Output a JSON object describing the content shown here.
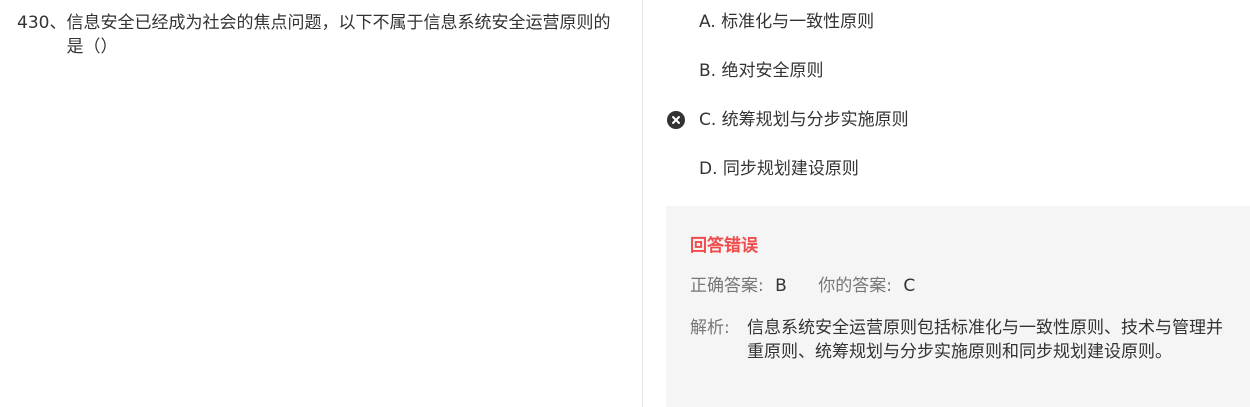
{
  "question": {
    "number": "430、",
    "text": "信息安全已经成为社会的焦点问题，以下不属于信息系统安全运营原则的是（）"
  },
  "options": [
    {
      "label": "A. 标准化与一致性原则",
      "selected": false
    },
    {
      "label": "B. 绝对安全原则",
      "selected": false
    },
    {
      "label": "C. 统筹规划与分步实施原则",
      "selected": true,
      "mark": "wrong-icon"
    },
    {
      "label": "D. 同步规划建设原则",
      "selected": false
    }
  ],
  "result": {
    "title": "回答错误",
    "title_color": "#f24b4b",
    "correct_label": "正确答案:",
    "correct_value": "B",
    "yours_label": "你的答案:",
    "yours_value": "C",
    "analysis_label": "解析:",
    "analysis_text": "信息系统安全运营原则包括标准化与一致性原则、技术与管理并重原则、统筹规划与分步实施原则和同步规划建设原则。"
  }
}
